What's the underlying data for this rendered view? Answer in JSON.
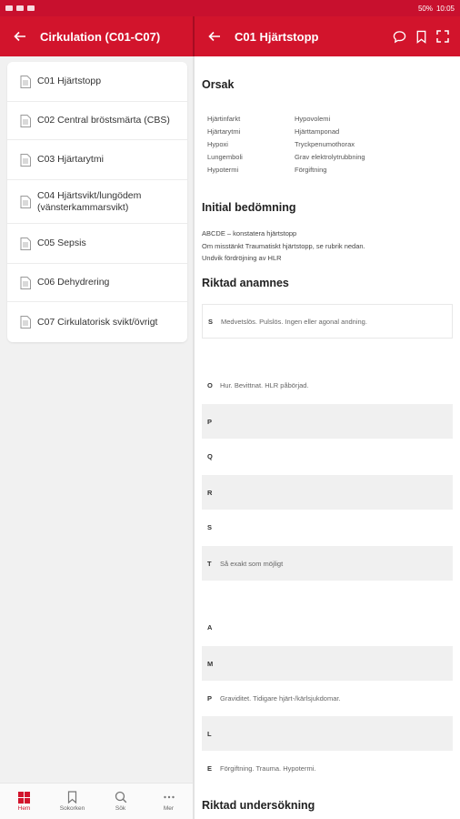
{
  "status_bar": {
    "battery": "50%",
    "time": "10:05"
  },
  "left_header": {
    "title": "Cirkulation (C01-C07)"
  },
  "right_header": {
    "title": "C01 Hjärtstopp"
  },
  "menu": [
    "C01 Hjärtstopp",
    "C02 Central bröstsmärta (CBS)",
    "C03 Hjärtarytmi",
    "C04 Hjärtsvikt/lungödem (vänsterkammarsvikt)",
    "C05 Sepsis",
    "C06 Dehydrering",
    "C07 Cirkulatorisk svikt/övrigt"
  ],
  "content": {
    "orsak_heading": "Orsak",
    "causes_left": [
      "Hjärtinfarkt",
      "Hjärtarytmi",
      "Hypoxi",
      "Lungemboli",
      "Hypotermi"
    ],
    "causes_right": [
      "Hypovolemi",
      "Hjärttamponad",
      "Tryckpenumothorax",
      "Grav elektrolytrubbning",
      "Förgiftning"
    ],
    "initial_heading": "Initial bedömning",
    "initial_lines": [
      "ABCDE – konstatera hjärtstopp",
      "Om misstänkt Traumatiskt hjärtstopp, se rubrik nedan.",
      "Undvik fördröjning av HLR"
    ],
    "anamnes_heading": "Riktad anamnes",
    "sociart": [
      {
        "letter": "S",
        "text": "Medvetslös. Pulslös. Ingen eller agonal andning."
      },
      {
        "letter": "O",
        "text": "Hur. Bevittnat. HLR påbörjad."
      },
      {
        "letter": "P",
        "text": ""
      },
      {
        "letter": "Q",
        "text": ""
      },
      {
        "letter": "R",
        "text": ""
      },
      {
        "letter": "S",
        "text": ""
      },
      {
        "letter": "T",
        "text": "Så exakt som möjligt"
      }
    ],
    "ample": [
      {
        "letter": "A",
        "text": ""
      },
      {
        "letter": "M",
        "text": ""
      },
      {
        "letter": "P",
        "text": "Graviditet. Tidigare hjärt-/kärlsjukdomar."
      },
      {
        "letter": "L",
        "text": ""
      },
      {
        "letter": "E",
        "text": "Förgiftning. Trauma. Hypotermi."
      }
    ],
    "undersokning_heading": "Riktad undersökning"
  },
  "bottom_nav": [
    {
      "label": "Hem",
      "icon": "home-grid-icon"
    },
    {
      "label": "Sokorken",
      "icon": "bookmark-icon"
    },
    {
      "label": "Sök",
      "icon": "search-icon"
    },
    {
      "label": "Mer",
      "icon": "more-icon"
    }
  ],
  "colors": {
    "primary": "#d2142c",
    "status": "#c8102e"
  }
}
